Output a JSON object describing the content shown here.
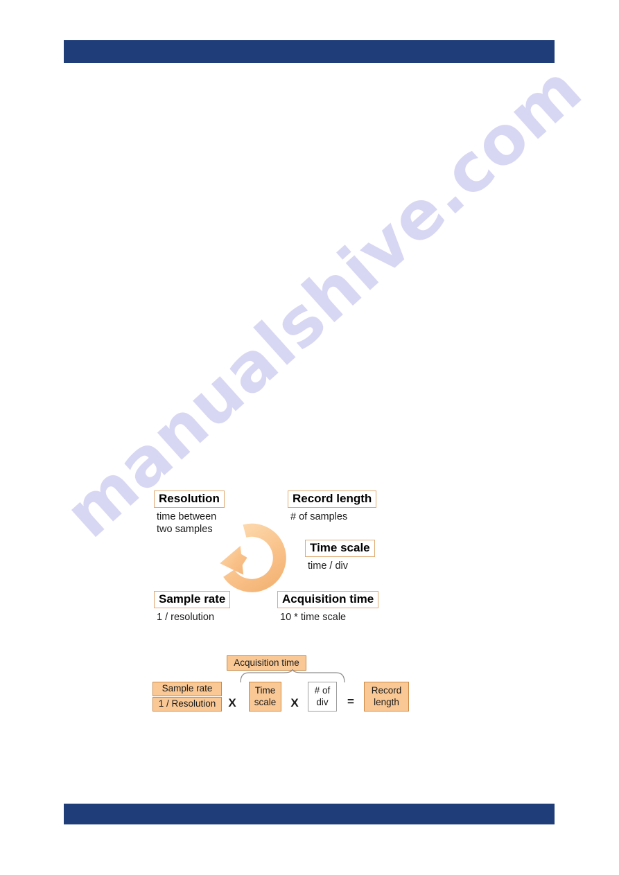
{
  "page": {
    "background_color": "#ffffff",
    "bar_color": "#1f3d79",
    "accent_orange": "#f9c895",
    "accent_orange_border": "#c98a48",
    "title_box_border": "#e0a972"
  },
  "watermark": {
    "text": "manualshive.com",
    "color": "#cdcdf0"
  },
  "header": {
    "bar_label": ""
  },
  "footer": {
    "bar_label": ""
  },
  "cycle_diagram": {
    "caption": "",
    "arrow_icon": "circular-arrow-icon",
    "terms": [
      {
        "title": "Resolution",
        "desc": "time between\ntwo samples"
      },
      {
        "title": "Record length",
        "desc": "# of samples"
      },
      {
        "title": "Time scale",
        "desc": "time / div"
      },
      {
        "title": "Sample rate",
        "desc": "1 / resolution"
      },
      {
        "title": "Acquisition time",
        "desc": "10 * time scale"
      }
    ]
  },
  "formula_diagram": {
    "acquisition_group_label": "Acquisition time",
    "sample_rate_label": "Sample rate",
    "one_over_resolution_label": "1 / Resolution",
    "time_scale_label": "Time\nscale",
    "num_of_div_label": "# of\ndiv",
    "record_length_label": "Record\nlength",
    "operator_multiply_1": "X",
    "operator_multiply_2": "X",
    "operator_equals": "="
  }
}
